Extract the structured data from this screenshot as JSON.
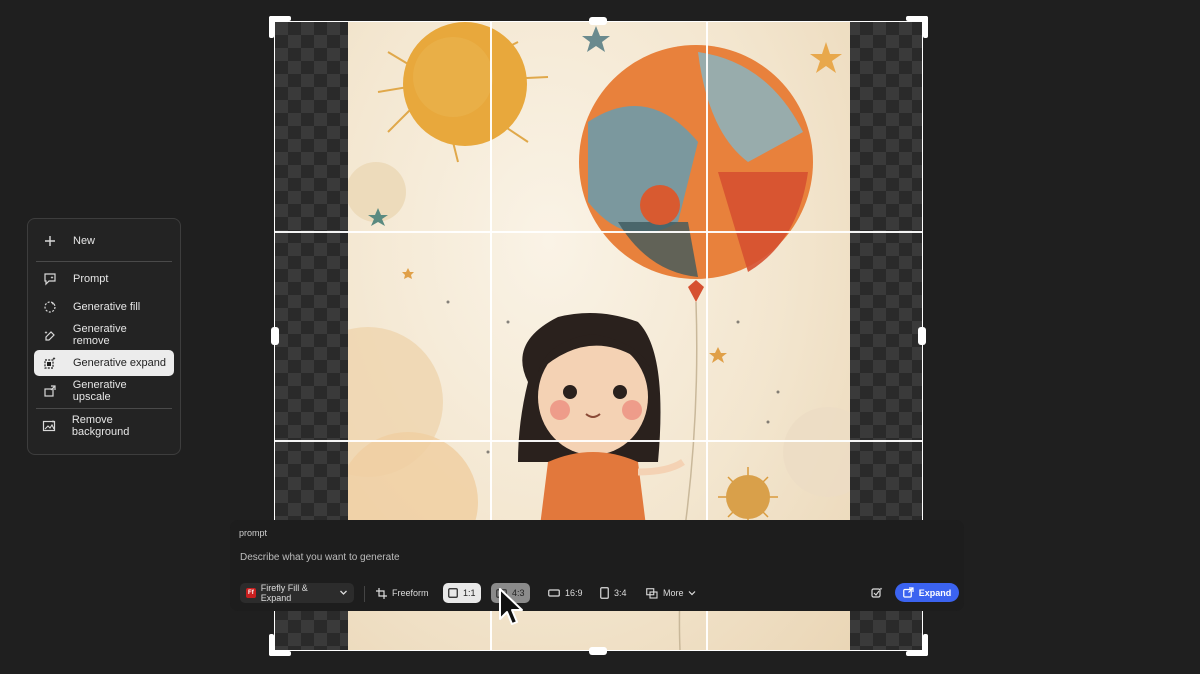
{
  "menu": {
    "new_label": "New",
    "items": [
      {
        "label": "Prompt",
        "icon": "prompt-icon"
      },
      {
        "label": "Generative fill",
        "icon": "generative-fill-icon"
      },
      {
        "label": "Generative remove",
        "icon": "generative-remove-icon"
      },
      {
        "label": "Generative expand",
        "icon": "generative-expand-icon",
        "active": true
      },
      {
        "label": "Generative upscale",
        "icon": "generative-upscale-icon"
      }
    ],
    "remove_background_label": "Remove background"
  },
  "prompt": {
    "label": "prompt",
    "placeholder": "Describe what you want to generate"
  },
  "toolbar": {
    "model_label": "Firefly Fill & Expand",
    "model_logo": "Ff",
    "freeform_label": "Freeform",
    "ratios": [
      "1:1",
      "4:3",
      "16:9",
      "3:4"
    ],
    "selected_ratio": "1:1",
    "more_label": "More",
    "expand_label": "Expand"
  },
  "colors": {
    "accent": "#3b63f0",
    "background": "#1f1f1f",
    "menu_active": "#ececec"
  }
}
